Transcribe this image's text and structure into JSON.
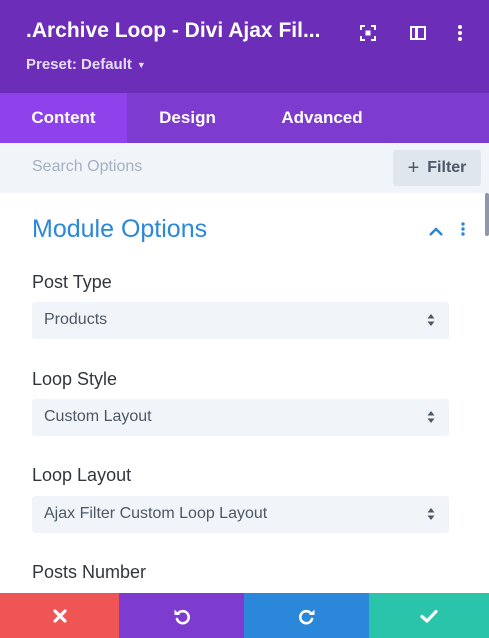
{
  "header": {
    "title": ".Archive Loop - Divi Ajax Fil...",
    "preset": "Preset: Default"
  },
  "tabs": [
    {
      "label": "Content",
      "active": true
    },
    {
      "label": "Design",
      "active": false
    },
    {
      "label": "Advanced",
      "active": false
    }
  ],
  "search": {
    "placeholder": "Search Options",
    "filter_label": "Filter"
  },
  "section": {
    "title": "Module Options"
  },
  "fields": [
    {
      "label": "Post Type",
      "value": "Products"
    },
    {
      "label": "Loop Style",
      "value": "Custom Layout"
    },
    {
      "label": "Loop Layout",
      "value": "Ajax Filter Custom Loop Layout"
    },
    {
      "label": "Posts Number"
    }
  ],
  "icons": {
    "focus": "focus-icon",
    "sidebar": "sidebar-toggle-icon",
    "menu": "more-options-icon",
    "collapse": "chevron-up-icon",
    "discard": "close-icon",
    "undo": "undo-icon",
    "redo": "redo-icon",
    "save": "check-icon"
  },
  "colors": {
    "header_bg": "#6c2eb9",
    "tabs_bg": "#7e3bd0",
    "active_tab_bg": "#8f42ec",
    "accent_blue": "#2b87da",
    "discard": "#ef5555",
    "undo": "#7e3bd0",
    "redo": "#2b87da",
    "save": "#29c4a9"
  }
}
